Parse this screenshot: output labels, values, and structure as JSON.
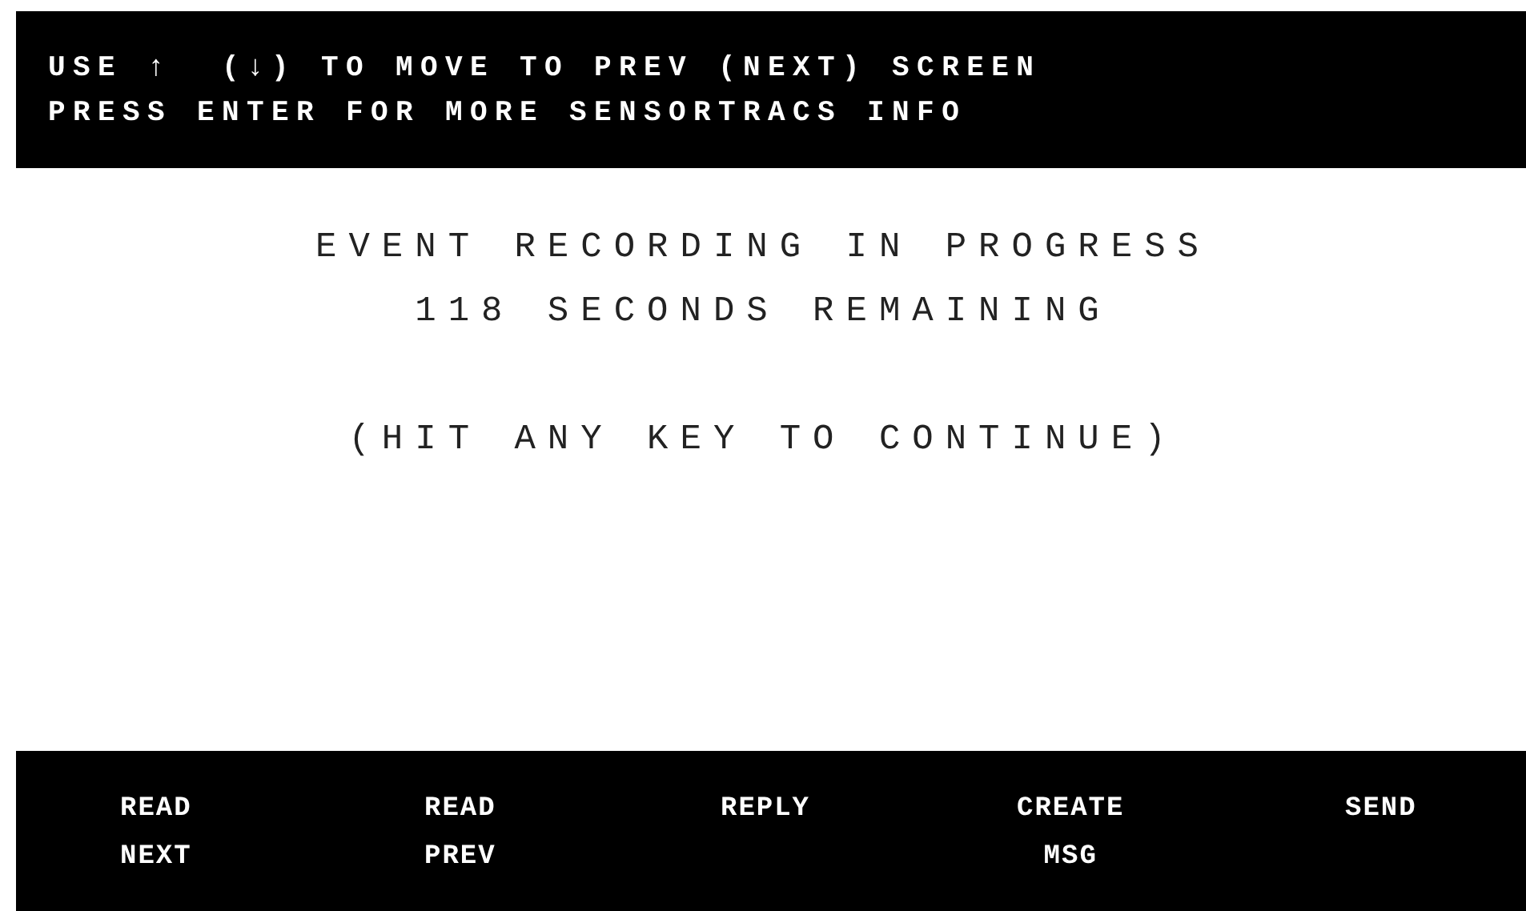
{
  "header": {
    "lines": [
      "USE ↑  (↓) TO MOVE TO PREV (NEXT) SCREEN",
      "PRESS ENTER FOR MORE SENSORTRACS INFO"
    ]
  },
  "message": {
    "lines": [
      "EVENT RECORDING IN PROGRESS",
      "118 SECONDS REMAINING"
    ],
    "prompt": "(HIT ANY KEY TO CONTINUE)"
  },
  "soft_keys": [
    {
      "lines": [
        "READ",
        "NEXT"
      ]
    },
    {
      "lines": [
        "READ",
        "PREV"
      ]
    },
    {
      "lines": [
        "REPLY"
      ]
    },
    {
      "lines": [
        "CREATE",
        "MSG"
      ]
    },
    {
      "lines": [
        "SEND"
      ]
    }
  ]
}
